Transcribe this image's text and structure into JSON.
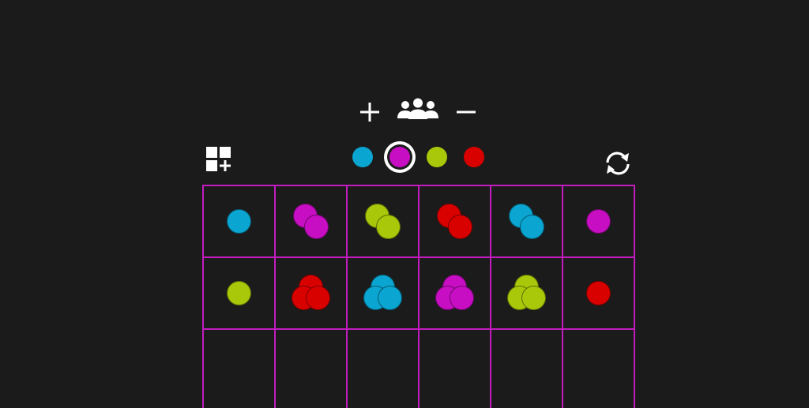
{
  "theme": {
    "background": "#1b1b1b",
    "grid_color": "#c21cbf",
    "icon_color": "#ffffff"
  },
  "controls": {
    "add_player_icon": "plus-icon",
    "players_icon": "group-icon",
    "remove_player_icon": "minus-icon",
    "add_grid_icon": "grid-add-icon",
    "restart_icon": "refresh-icon"
  },
  "players": [
    {
      "color": "#0aa5d0",
      "selected": false
    },
    {
      "color": "#c70ec3",
      "selected": true
    },
    {
      "color": "#a9c80a",
      "selected": false
    },
    {
      "color": "#d90000",
      "selected": false
    }
  ],
  "board": {
    "columns": 6,
    "visible_rows": 3,
    "cells": [
      [
        {
          "player": 0,
          "count": 1
        },
        {
          "player": 1,
          "count": 2
        },
        {
          "player": 2,
          "count": 2
        },
        {
          "player": 3,
          "count": 2
        },
        {
          "player": 0,
          "count": 2
        },
        {
          "player": 1,
          "count": 1
        }
      ],
      [
        {
          "player": 2,
          "count": 1
        },
        {
          "player": 3,
          "count": 3
        },
        {
          "player": 0,
          "count": 3
        },
        {
          "player": 1,
          "count": 3
        },
        {
          "player": 2,
          "count": 3
        },
        {
          "player": 3,
          "count": 1
        }
      ],
      [
        {
          "player": null,
          "count": 0
        },
        {
          "player": null,
          "count": 0
        },
        {
          "player": null,
          "count": 0
        },
        {
          "player": null,
          "count": 0
        },
        {
          "player": null,
          "count": 0
        },
        {
          "player": null,
          "count": 0
        }
      ]
    ]
  }
}
